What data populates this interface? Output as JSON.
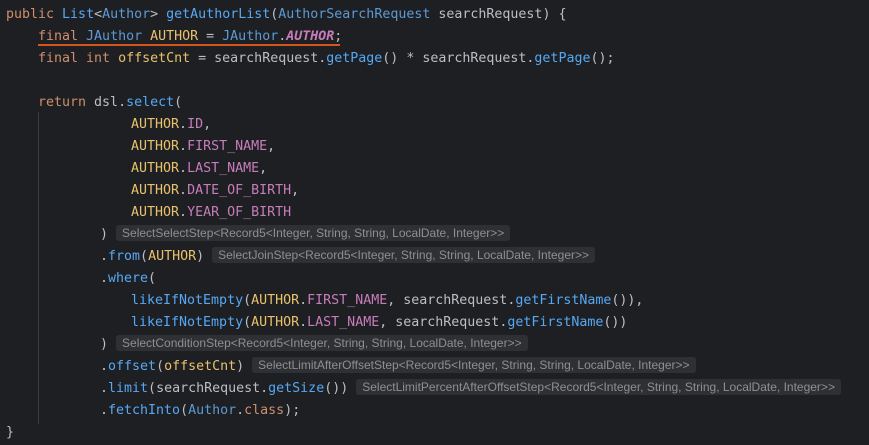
{
  "editor": {
    "theme": "dark",
    "background": "#1e1f22",
    "underline_color": "#d5561c"
  },
  "code": {
    "lines": [
      [
        [
          "kw",
          "public "
        ],
        [
          "cls",
          "List"
        ],
        [
          "pun",
          "<"
        ],
        [
          "typ",
          "Author"
        ],
        [
          "pun",
          "> "
        ],
        [
          "fn",
          "getAuthorList"
        ],
        [
          "pun",
          "("
        ],
        [
          "typ",
          "AuthorSearchRequest"
        ],
        [
          "id",
          " searchRequest"
        ],
        [
          "pun",
          ") {"
        ]
      ],
      [
        [
          "kw",
          "final "
        ],
        [
          "typ",
          "JAuthor"
        ],
        [
          "cname",
          " AUTHOR"
        ],
        [
          "pun",
          " = "
        ],
        [
          "typ",
          "JAuthor"
        ],
        [
          "pun",
          "."
        ],
        [
          "con",
          "AUTHOR"
        ],
        [
          "pun",
          ";"
        ]
      ],
      [
        [
          "kw",
          "final int "
        ],
        [
          "cname",
          "offsetCnt"
        ],
        [
          "pun",
          " = "
        ],
        [
          "id",
          "searchRequest"
        ],
        [
          "pun",
          "."
        ],
        [
          "mth",
          "getPage"
        ],
        [
          "pun",
          "() * "
        ],
        [
          "id",
          "searchRequest"
        ],
        [
          "pun",
          "."
        ],
        [
          "mth",
          "getPage"
        ],
        [
          "pun",
          "();"
        ]
      ],
      [],
      [
        [
          "kw",
          "return "
        ],
        [
          "id",
          "dsl"
        ],
        [
          "pun",
          "."
        ],
        [
          "mth",
          "select"
        ],
        [
          "pun",
          "("
        ]
      ],
      [
        [
          "cname",
          "AUTHOR"
        ],
        [
          "pun",
          "."
        ],
        [
          "fld",
          "ID"
        ],
        [
          "pun",
          ","
        ]
      ],
      [
        [
          "cname",
          "AUTHOR"
        ],
        [
          "pun",
          "."
        ],
        [
          "fld",
          "FIRST_NAME"
        ],
        [
          "pun",
          ","
        ]
      ],
      [
        [
          "cname",
          "AUTHOR"
        ],
        [
          "pun",
          "."
        ],
        [
          "fld",
          "LAST_NAME"
        ],
        [
          "pun",
          ","
        ]
      ],
      [
        [
          "cname",
          "AUTHOR"
        ],
        [
          "pun",
          "."
        ],
        [
          "fld",
          "DATE_OF_BIRTH"
        ],
        [
          "pun",
          ","
        ]
      ],
      [
        [
          "cname",
          "AUTHOR"
        ],
        [
          "pun",
          "."
        ],
        [
          "fld",
          "YEAR_OF_BIRTH"
        ]
      ],
      [
        [
          "pun",
          ")"
        ]
      ],
      [
        [
          "pun",
          "."
        ],
        [
          "mth",
          "from"
        ],
        [
          "pun",
          "("
        ],
        [
          "cname",
          "AUTHOR"
        ],
        [
          "pun",
          ")"
        ]
      ],
      [
        [
          "pun",
          "."
        ],
        [
          "mth",
          "where"
        ],
        [
          "pun",
          "("
        ]
      ],
      [
        [
          "mth",
          "likeIfNotEmpty"
        ],
        [
          "pun",
          "("
        ],
        [
          "cname",
          "AUTHOR"
        ],
        [
          "pun",
          "."
        ],
        [
          "fld",
          "FIRST_NAME"
        ],
        [
          "pun",
          ", "
        ],
        [
          "id",
          "searchRequest"
        ],
        [
          "pun",
          "."
        ],
        [
          "mth",
          "getFirstName"
        ],
        [
          "pun",
          "()),"
        ]
      ],
      [
        [
          "mth",
          "likeIfNotEmpty"
        ],
        [
          "pun",
          "("
        ],
        [
          "cname",
          "AUTHOR"
        ],
        [
          "pun",
          "."
        ],
        [
          "fld",
          "LAST_NAME"
        ],
        [
          "pun",
          ", "
        ],
        [
          "id",
          "searchRequest"
        ],
        [
          "pun",
          "."
        ],
        [
          "mth",
          "getFirstName"
        ],
        [
          "pun",
          "())"
        ]
      ],
      [
        [
          "pun",
          ")"
        ]
      ],
      [
        [
          "pun",
          "."
        ],
        [
          "mth",
          "offset"
        ],
        [
          "pun",
          "("
        ],
        [
          "cname",
          "offsetCnt"
        ],
        [
          "pun",
          ")"
        ]
      ],
      [
        [
          "pun",
          "."
        ],
        [
          "mth",
          "limit"
        ],
        [
          "pun",
          "("
        ],
        [
          "id",
          "searchRequest"
        ],
        [
          "pun",
          "."
        ],
        [
          "mth",
          "getSize"
        ],
        [
          "pun",
          "())"
        ]
      ],
      [
        [
          "pun",
          "."
        ],
        [
          "mth",
          "fetchInto"
        ],
        [
          "pun",
          "("
        ],
        [
          "typ",
          "Author"
        ],
        [
          "pun",
          "."
        ],
        [
          "kw",
          "class"
        ],
        [
          "pun",
          ");"
        ]
      ],
      [],
      [
        [
          "pun",
          "}"
        ]
      ]
    ],
    "hints": {
      "10": "SelectSelectStep<Record5<Integer, String, String, LocalDate, Integer>>",
      "11": "SelectJoinStep<Record5<Integer, String, String, LocalDate, Integer>>",
      "15": "SelectConditionStep<Record5<Integer, String, String, LocalDate, Integer>>",
      "16": "SelectLimitAfterOffsetStep<Record5<Integer, String, String, LocalDate, Integer>>",
      "17": "SelectLimitPercentAfterOffsetStep<Record5<Integer, String, String, LocalDate, Integer>>"
    }
  }
}
